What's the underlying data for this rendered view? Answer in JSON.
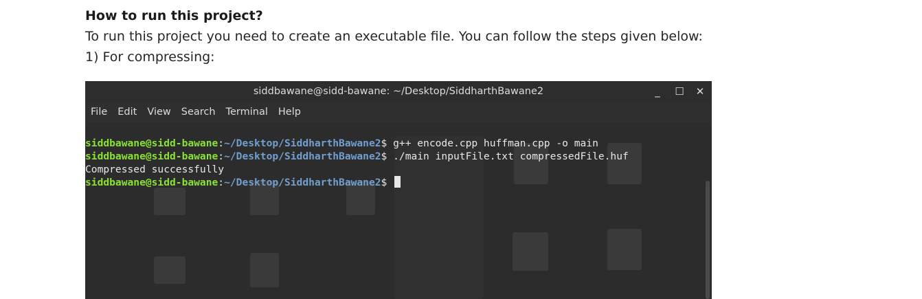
{
  "heading": "How to run this project?",
  "intro": "To run this project you need to create an executable file. You can follow the steps given below:",
  "step": "1) For compressing:",
  "terminal": {
    "title": "siddbawane@sidd-bawane: ~/Desktop/SiddharthBawane2",
    "window_controls": [
      "minimize-icon",
      "maximize-icon",
      "close-icon"
    ],
    "menu": [
      "File",
      "Edit",
      "View",
      "Search",
      "Terminal",
      "Help"
    ],
    "user": "siddbawane@sidd-bawane",
    "path": "~/Desktop/SiddharthBawane2",
    "cmd1": " g++ encode.cpp huffman.cpp -o main",
    "cmd2": " ./main inputFile.txt compressedFile.huf",
    "output": "Compressed successfully",
    "colors": {
      "user": "#8ae234",
      "path": "#729fcf",
      "background": "#2b2b2b"
    }
  }
}
